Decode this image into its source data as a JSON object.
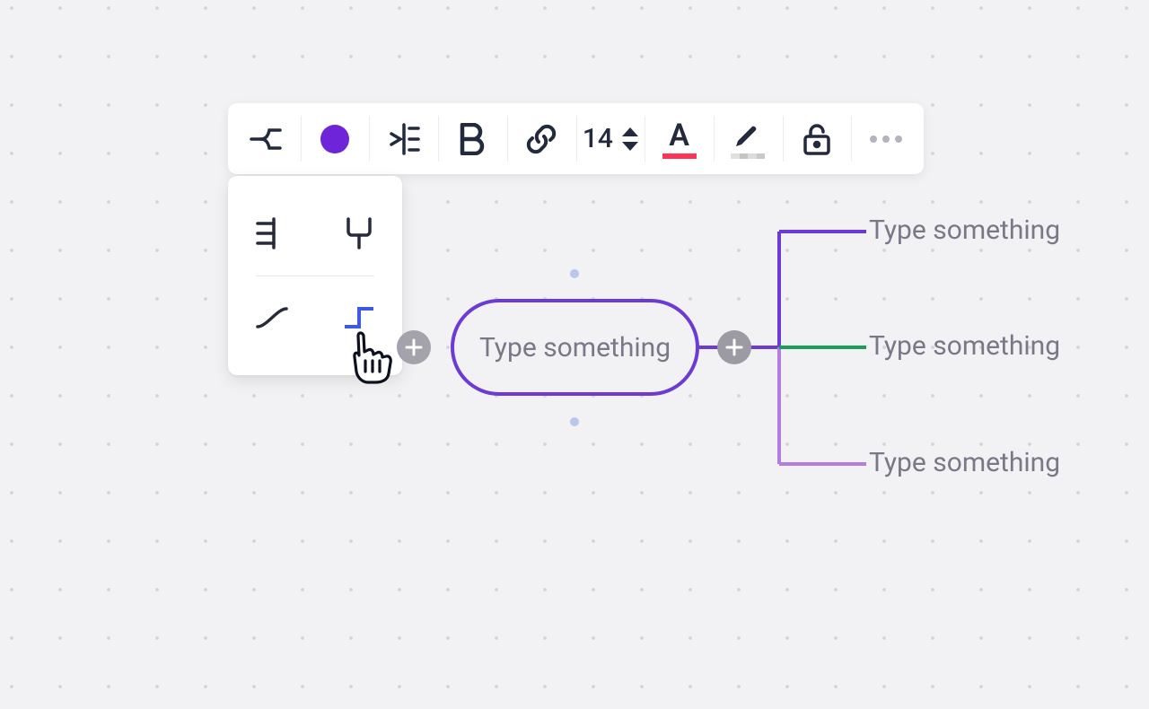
{
  "colors": {
    "shape_fill": "#6e24d9",
    "central_border": "#6e3ad6",
    "branch_top": "#6e3ad6",
    "branch_mid": "#1b9e58",
    "branch_bot": "#b47ee0",
    "font_underline": "#ff3355",
    "text_muted": "#7a7786",
    "toolbar_icon": "#232a3d",
    "selected_line_style": "#3d5ae0"
  },
  "toolbar": {
    "font_size": "14"
  },
  "dropdown": {
    "selected": "elbow"
  },
  "central": {
    "placeholder": "Type something"
  },
  "children": [
    {
      "placeholder": "Type something"
    },
    {
      "placeholder": "Type something"
    },
    {
      "placeholder": "Type something"
    }
  ]
}
